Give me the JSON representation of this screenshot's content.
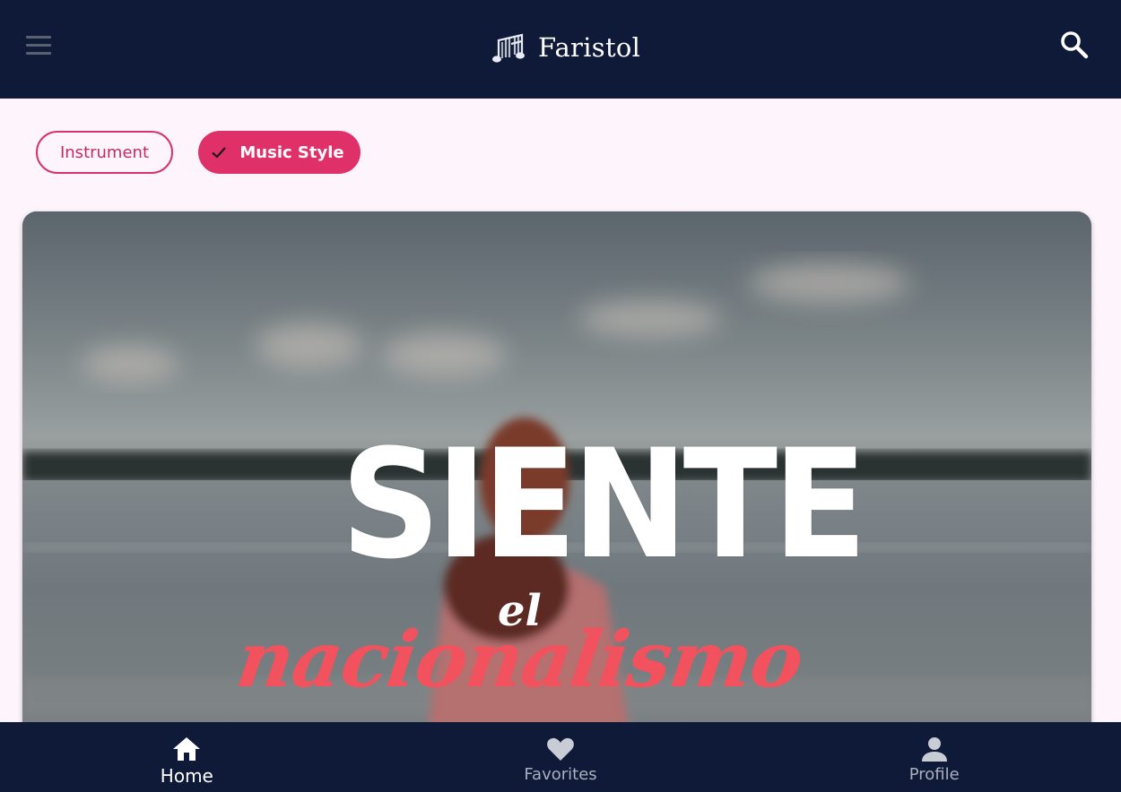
{
  "app": {
    "name": "Faristol"
  },
  "header": {
    "menu_icon": "menu-icon",
    "search_icon": "search-icon"
  },
  "filters": {
    "chips": [
      {
        "label": "Instrument",
        "selected": false
      },
      {
        "label": "Music Style",
        "selected": true,
        "icon": "check-icon"
      }
    ]
  },
  "card": {
    "title": "SIENTE",
    "connector": "el",
    "subtitle": "nacionalismo"
  },
  "bottom_nav": {
    "items": [
      {
        "label": "Home",
        "icon": "home-icon",
        "active": true
      },
      {
        "label": "Favorites",
        "icon": "heart-icon",
        "active": false
      },
      {
        "label": "Profile",
        "icon": "person-icon",
        "active": false
      }
    ]
  },
  "colors": {
    "appbar": "#0e1a38",
    "accent": "#e0306a",
    "background": "#fdf5fb",
    "poster_accent": "#f2525d"
  }
}
